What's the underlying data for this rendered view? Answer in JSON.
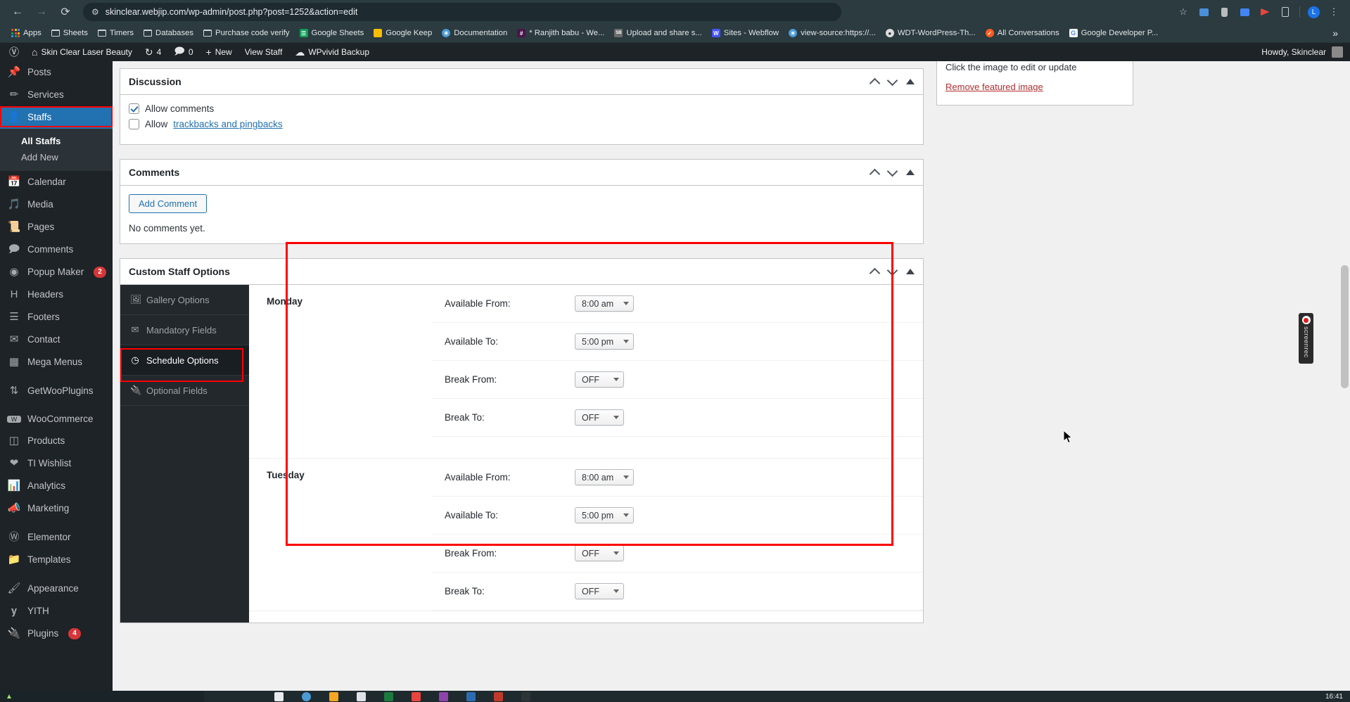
{
  "browser": {
    "url": "skinclear.webjip.com/wp-admin/post.php?post=1252&action=edit",
    "back_icon": "back-arrow-icon",
    "forward_icon": "forward-arrow-icon",
    "reload_icon": "reload-icon",
    "site_settings_icon": "site-settings-icon",
    "star_icon": "bookmark-star-icon",
    "profile_initial": "L",
    "menu_icon": "chrome-menu-icon",
    "bookmarks": [
      {
        "label": "Apps",
        "icon": "apps-grid-icon"
      },
      {
        "label": "Sheets",
        "icon": "folder-icon"
      },
      {
        "label": "Timers",
        "icon": "folder-icon"
      },
      {
        "label": "Databases",
        "icon": "folder-icon"
      },
      {
        "label": "Purchase code verify",
        "icon": "folder-icon"
      },
      {
        "label": "Google Sheets",
        "icon": "google-sheets-icon",
        "color": "#0f9d58"
      },
      {
        "label": "Google Keep",
        "icon": "google-keep-icon",
        "color": "#fbbc04"
      },
      {
        "label": "Documentation",
        "icon": "globe-icon",
        "color": "#4a9ad4"
      },
      {
        "label": "* Ranjith babu - We...",
        "icon": "slack-icon",
        "color": "#e01e5a"
      },
      {
        "label": "Upload and share s...",
        "icon": "sendbird-icon",
        "color": "#6c6c6c"
      },
      {
        "label": "Sites - Webflow",
        "icon": "webflow-icon",
        "color": "#4353ff"
      },
      {
        "label": "view-source:https://...",
        "icon": "globe-icon",
        "color": "#4a9ad4"
      },
      {
        "label": "WDT-WordPress-Th...",
        "icon": "github-icon",
        "color": "#24292e"
      },
      {
        "label": "All Conversations",
        "icon": "intercom-icon",
        "color": "#ff5b1f"
      },
      {
        "label": "Google Developer P...",
        "icon": "google-icon",
        "color": "#ffffff"
      }
    ],
    "overflow_label": "»"
  },
  "adminbar": {
    "wp_logo": "wordpress-logo-icon",
    "site_name": "Skin Clear Laser Beauty",
    "updates_count": "4",
    "comments_count": "0",
    "new_label": "New",
    "view_staff_label": "View Staff",
    "wpvivid_label": "WPvivid Backup",
    "howdy": "Howdy, Skinclear"
  },
  "sidebar": {
    "items": [
      {
        "label": "Posts",
        "icon": "pin-icon",
        "current": false
      },
      {
        "label": "Services",
        "icon": "carrot-icon",
        "current": false
      },
      {
        "label": "Staffs",
        "icon": "user-icon",
        "current": true
      },
      {
        "label": "Calendar",
        "icon": "calendar-icon",
        "current": false
      },
      {
        "label": "Media",
        "icon": "media-icon",
        "current": false
      },
      {
        "label": "Pages",
        "icon": "pages-icon",
        "current": false
      },
      {
        "label": "Comments",
        "icon": "comment-icon",
        "current": false
      },
      {
        "label": "Popup Maker",
        "icon": "popup-icon",
        "current": false,
        "badge": "2"
      },
      {
        "label": "Headers",
        "icon": "header-h-icon",
        "current": false
      },
      {
        "label": "Footers",
        "icon": "footer-icon",
        "current": false
      },
      {
        "label": "Contact",
        "icon": "envelope-icon",
        "current": false
      },
      {
        "label": "Mega Menus",
        "icon": "grid-table-icon",
        "current": false
      },
      {
        "label": "GetWooPlugins",
        "icon": "sliders-icon",
        "current": false
      },
      {
        "label": "WooCommerce",
        "icon": "woo-icon",
        "current": false
      },
      {
        "label": "Products",
        "icon": "products-box-icon",
        "current": false
      },
      {
        "label": "TI Wishlist",
        "icon": "heart-icon",
        "current": false
      },
      {
        "label": "Analytics",
        "icon": "bar-chart-icon",
        "current": false
      },
      {
        "label": "Marketing",
        "icon": "megaphone-icon",
        "current": false
      },
      {
        "label": "Elementor",
        "icon": "elementor-icon",
        "current": false
      },
      {
        "label": "Templates",
        "icon": "folder-open-icon",
        "current": false
      },
      {
        "label": "Appearance",
        "icon": "paintbrush-icon",
        "current": false
      },
      {
        "label": "YITH",
        "icon": "yith-icon",
        "current": false
      },
      {
        "label": "Plugins",
        "icon": "plug-icon",
        "current": false,
        "badge": "4"
      }
    ],
    "submenu": [
      {
        "label": "All Staffs",
        "current": true
      },
      {
        "label": "Add New",
        "current": false
      }
    ]
  },
  "discussion": {
    "title": "Discussion",
    "allow_comments_label": "Allow comments",
    "allow_comments_checked": true,
    "allow_prefix": "Allow",
    "trackbacks_link": "trackbacks and pingbacks",
    "trackbacks_checked": false
  },
  "comments": {
    "title": "Comments",
    "add_comment_label": "Add Comment",
    "empty_text": "No comments yet."
  },
  "custom_staff_options": {
    "title": "Custom Staff Options",
    "tabs": [
      {
        "label": "Gallery Options",
        "icon": "image-icon",
        "active": false
      },
      {
        "label": "Mandatory Fields",
        "icon": "envelope-icon",
        "active": false
      },
      {
        "label": "Schedule Options",
        "icon": "clock-icon",
        "active": true
      },
      {
        "label": "Optional Fields",
        "icon": "plug-icon",
        "active": false
      }
    ],
    "days": [
      {
        "name": "Monday",
        "fields": [
          {
            "label": "Available From:",
            "value": "8:00 am"
          },
          {
            "label": "Available To:",
            "value": "5:00 pm"
          },
          {
            "label": "Break From:",
            "value": "OFF"
          },
          {
            "label": "Break To:",
            "value": "OFF"
          }
        ]
      },
      {
        "name": "Tuesday",
        "fields": [
          {
            "label": "Available From:",
            "value": "8:00 am"
          },
          {
            "label": "Available To:",
            "value": "5:00 pm"
          },
          {
            "label": "Break From:",
            "value": "OFF"
          },
          {
            "label": "Break To:",
            "value": "OFF"
          }
        ]
      }
    ]
  },
  "featured_image": {
    "caption": "Click the image to edit or update",
    "remove_label": "Remove featured image"
  },
  "screenrec": {
    "label": "screenrec",
    "record_icon": "record-dot-icon"
  },
  "taskbar": {
    "time": "16:41",
    "start_icon": "start-icon"
  },
  "colors": {
    "accent": "#2271b1",
    "annotation": "#ff0000",
    "admin_bg": "#1d2327",
    "badge": "#d63638"
  }
}
